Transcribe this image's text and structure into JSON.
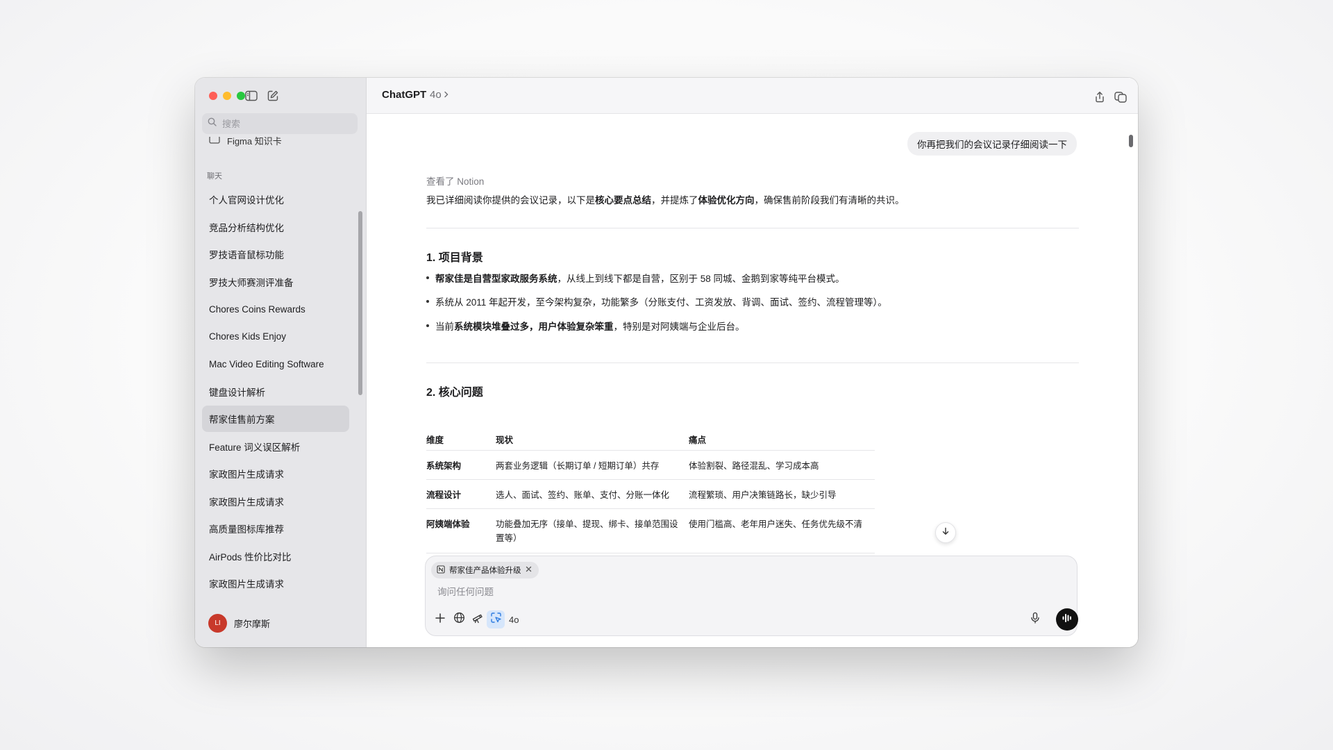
{
  "app": {
    "title": "ChatGPT",
    "model": "4o"
  },
  "sidebar": {
    "search_placeholder": "搜索",
    "pinned_item": "Figma 知识卡",
    "section_label": "聊天",
    "items": [
      {
        "label": "个人官网设计优化"
      },
      {
        "label": "竞品分析结构优化"
      },
      {
        "label": "罗技语音鼠标功能"
      },
      {
        "label": "罗技大师赛测评准备"
      },
      {
        "label": "Chores Coins Rewards"
      },
      {
        "label": "Chores Kids Enjoy"
      },
      {
        "label": "Mac Video Editing Software"
      },
      {
        "label": "键盘设计解析"
      },
      {
        "label": "帮家佳售前方案",
        "active": true
      },
      {
        "label": "Feature 词义误区解析"
      },
      {
        "label": "家政图片生成请求"
      },
      {
        "label": "家政图片生成请求"
      },
      {
        "label": "高质量图标库推荐"
      },
      {
        "label": "AirPods 性价比对比"
      },
      {
        "label": "家政图片生成请求"
      }
    ],
    "user": {
      "avatar_initials": "LI",
      "name": "廖尔摩斯"
    }
  },
  "conversation": {
    "user_message": "你再把我们的会议记录仔细阅读一下",
    "viewed_source": "查看了 Notion",
    "intro": {
      "part1": "我已详细阅读你提供的会议记录，以下是",
      "bold1": "核心要点总结",
      "part2": "，并提炼了",
      "bold2": "体验优化方向",
      "part3": "，确保售前阶段我们有清晰的共识。"
    },
    "section1": {
      "heading": "1. 项目背景",
      "bullets": [
        {
          "bold": "帮家佳是自营型家政服务系统",
          "text": "，从线上到线下都是自营，区别于 58 同城、金鹅到家等纯平台模式。"
        },
        {
          "pre": "系统从 2011 年起开发，至今架构复杂，功能繁多（分账支付、工资发放、背调、面试、签约、流程管理等）。"
        },
        {
          "pre": "当前",
          "bold": "系统模块堆叠过多，用户体验复杂笨重",
          "text": "，特别是对阿姨端与企业后台。"
        }
      ]
    },
    "section2": {
      "heading": "2. 核心问题",
      "columns": [
        "维度",
        "现状",
        "痛点"
      ],
      "rows": [
        [
          "系统架构",
          "两套业务逻辑（长期订单 / 短期订单）共存",
          "体验割裂、路径混乱、学习成本高"
        ],
        [
          "流程设计",
          "选人、面试、签约、账单、支付、分账一体化",
          "流程繁琐、用户决策链路长，缺少引导"
        ],
        [
          "阿姨端体验",
          "功能叠加无序（接单、提现、绑卡、接单范围设置等）",
          "使用门槛高、老年用户迷失、任务优先级不清"
        ]
      ]
    }
  },
  "composer": {
    "attachment": "帮家佳产品体验升级",
    "placeholder": "询问任何问题",
    "model_label": "4o"
  },
  "icons": {
    "sidebar_toggle": "sidebar-icon",
    "new_chat": "compose-icon",
    "share": "share-icon",
    "new_window": "window-icon",
    "search": "search-icon"
  }
}
